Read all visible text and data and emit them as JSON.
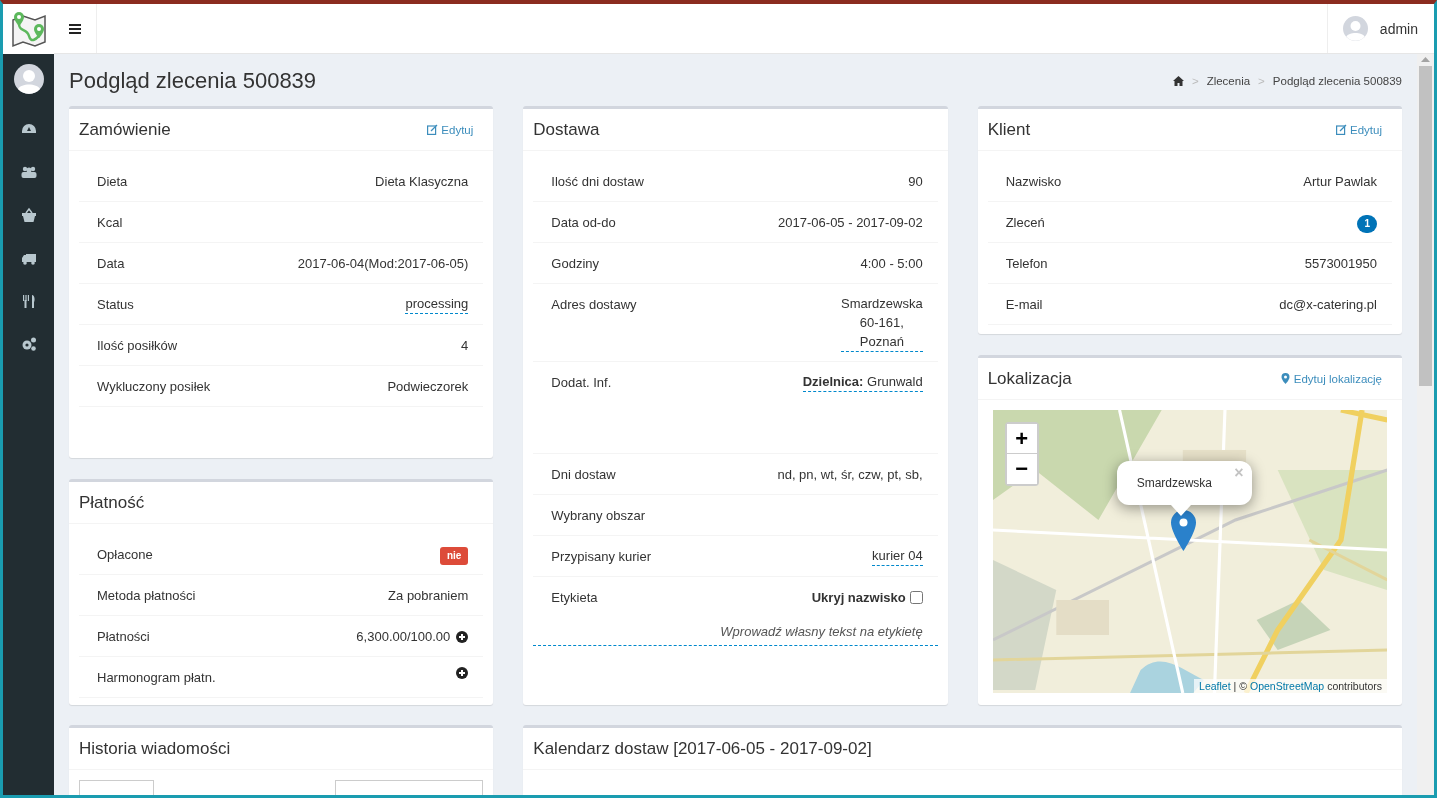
{
  "header": {
    "user": "admin"
  },
  "page_title": "Podgląd zlecenia 500839",
  "breadcrumb": [
    "Zlecenia",
    "Podgląd zlecenia 500839"
  ],
  "breadcrumb_separator": ">",
  "order": {
    "title": "Zamówienie",
    "edit": "Edytuj",
    "rows": [
      {
        "kind": "text",
        "label": "Dieta",
        "value": "Dieta Klasyczna"
      },
      {
        "kind": "text",
        "label": "Kcal"
      },
      {
        "kind": "text",
        "label": "Data",
        "value": "2017-06-04(Mod:2017-06-05)"
      },
      {
        "kind": "editable",
        "label": "Status",
        "value": "processing"
      },
      {
        "kind": "text",
        "label": "Ilość posiłków",
        "value": "4"
      },
      {
        "kind": "text",
        "label": "Wykluczony posiłek",
        "value": "Podwieczorek"
      }
    ]
  },
  "payment": {
    "title": "Płatność",
    "rows": [
      {
        "kind": "badge",
        "label": "Opłacone",
        "value": "nie",
        "color": "#dd4b39"
      },
      {
        "kind": "text",
        "label": "Metoda płatności",
        "value": "Za pobraniem"
      },
      {
        "kind": "add",
        "label": "Płatności",
        "value": "6,300.00/100.00"
      },
      {
        "kind": "add",
        "label": "Harmonogram płatn."
      }
    ]
  },
  "delivery": {
    "title": "Dostawa",
    "rows": [
      {
        "kind": "text",
        "label": "Ilość dni dostaw",
        "value": "90"
      },
      {
        "kind": "text",
        "label": "Data od-do",
        "value": "2017-06-05 - 2017-09-02"
      },
      {
        "kind": "text",
        "label": "Godziny",
        "value": "4:00 - 5:00"
      },
      {
        "kind": "address",
        "label": "Adres dostawy",
        "lines": [
          "Smardzewska",
          "60-161,",
          "Poznań"
        ]
      },
      {
        "kind": "info",
        "label": "Dodat. Inf.",
        "value": "**Dzielnica:** Grunwald"
      },
      {
        "kind": "text",
        "label": "Dni dostaw",
        "value": "nd, pn, wt, śr, czw, pt, sb,"
      },
      {
        "kind": "text",
        "label": "Wybrany obszar"
      },
      {
        "kind": "editable",
        "label": "Przypisany kurier",
        "value": "kurier 04"
      },
      {
        "kind": "label",
        "label": "Etykieta",
        "checkbox": "Ukryj nazwisko",
        "checked": false,
        "placeholder": "Wprowadź własny tekst na etykietę"
      }
    ]
  },
  "client": {
    "title": "Klient",
    "edit": "Edytuj",
    "rows": [
      {
        "kind": "text",
        "label": "Nazwisko",
        "value": "Artur Pawlak"
      },
      {
        "kind": "badge",
        "label": "Zleceń",
        "value": "1",
        "color": "#0073b7"
      },
      {
        "kind": "text",
        "label": "Telefon",
        "value": "5573001950"
      },
      {
        "kind": "text",
        "label": "E-mail",
        "value": "dc@x-catering.pl"
      }
    ]
  },
  "location": {
    "title": "Lokalizacja",
    "edit": "Edytuj lokalizację",
    "map": {
      "kind": "picture",
      "popup": "Smardzewska",
      "close": "×",
      "zoom_in": "+",
      "zoom_out": "−",
      "attribution_link1": "Leaflet",
      "attribution_sep": "| ©",
      "attribution_link2": "OpenStreetMap",
      "attribution_text": "contributors"
    }
  },
  "history": {
    "title": "Historia wiadomości"
  },
  "calendar": {
    "title": "Kalendarz dostaw [2017-06-05 - 2017-09-02]"
  }
}
